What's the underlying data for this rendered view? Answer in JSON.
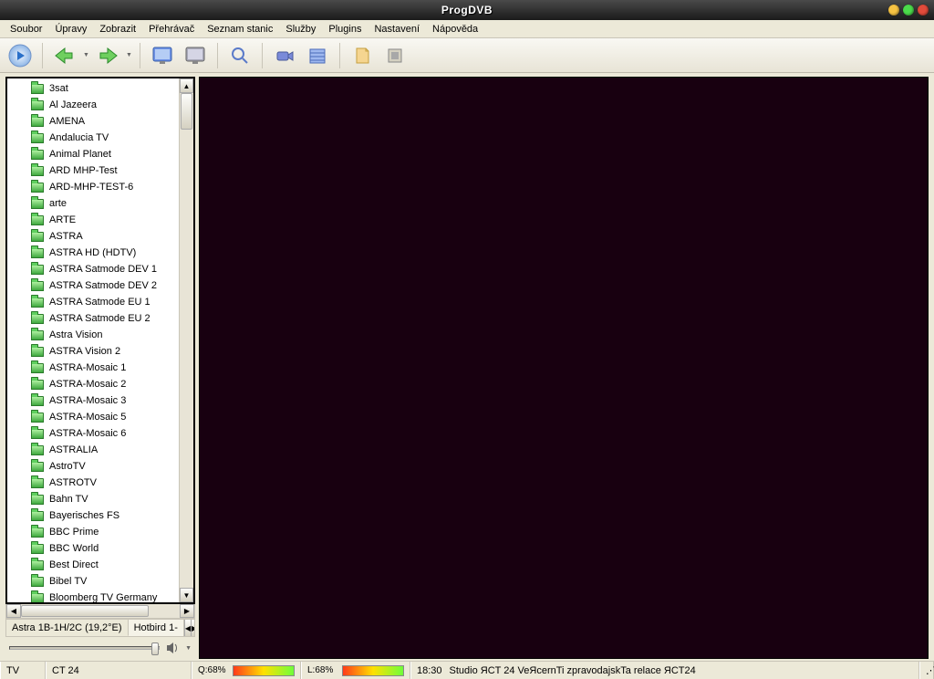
{
  "window": {
    "title": "ProgDVB"
  },
  "menu": {
    "items": [
      "Soubor",
      "Úpravy",
      "Zobrazit",
      "Přehrávač",
      "Seznam stanic",
      "Služby",
      "Plugins",
      "Nastavení",
      "Nápověda"
    ]
  },
  "channels": [
    "3sat",
    "Al Jazeera",
    "AMENA",
    "Andalucia TV",
    "Animal Planet",
    "ARD MHP-Test",
    "ARD-MHP-TEST-6",
    "arte",
    "ARTE",
    "ASTRA",
    "ASTRA HD (HDTV)",
    "ASTRA Satmode DEV 1",
    "ASTRA Satmode DEV 2",
    "ASTRA Satmode EU 1",
    "ASTRA Satmode EU 2",
    "Astra Vision",
    "ASTRA Vision 2",
    "ASTRA-Mosaic 1",
    "ASTRA-Mosaic 2",
    "ASTRA-Mosaic 3",
    "ASTRA-Mosaic 5",
    "ASTRA-Mosaic 6",
    "ASTRALIA",
    "AstroTV",
    "ASTROTV",
    "Bahn TV",
    "Bayerisches FS",
    "BBC Prime",
    "BBC World",
    "Best Direct",
    "Bibel TV",
    "Bloomberg TV Germany"
  ],
  "satellites": {
    "active": "Astra 1B-1H/2C (19,2°E)",
    "next": "Hotbird 1-"
  },
  "status": {
    "type": "TV",
    "channel": "CT 24",
    "q_label": "Q:68%",
    "l_label": "L:68%",
    "time": "18:30",
    "epg": "Studio ЯCT 24 VeЯcernTi zpravodajskTa relace ЯCT24"
  },
  "toolbar": {
    "play": "play",
    "back": "back",
    "fwd": "forward",
    "fullscr": "fullscreen",
    "desk": "desktop",
    "search": "search",
    "rec": "record",
    "sched": "scheduler",
    "notes": "notes",
    "opts": "options"
  }
}
